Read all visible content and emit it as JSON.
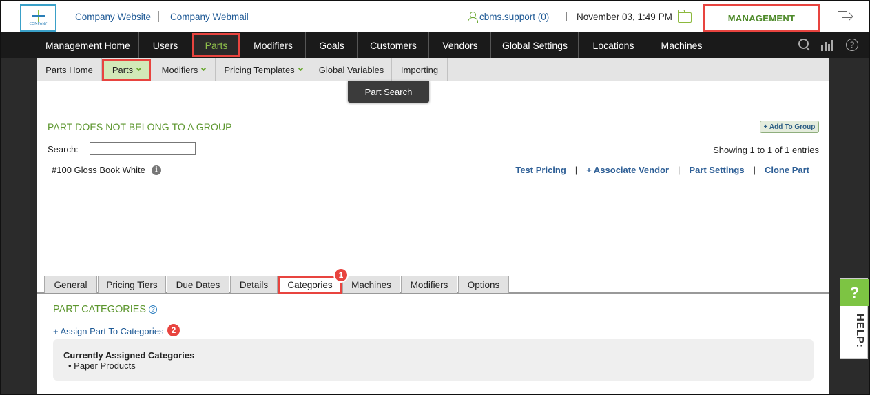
{
  "header": {
    "logo_text": "COMPANY",
    "links": [
      "Company Website",
      "Company Webmail"
    ],
    "user": "cbms.support (0)",
    "datetime": "November 03, 1:49 PM",
    "management_label": "MANAGEMENT"
  },
  "main_nav": {
    "items": [
      "Management Home",
      "Users",
      "Parts",
      "Modifiers",
      "Goals",
      "Customers",
      "Vendors",
      "Global Settings",
      "Locations",
      "Machines"
    ],
    "active": "Parts",
    "icons": [
      "search-icon",
      "chart-icon",
      "help-icon"
    ]
  },
  "sub_nav": {
    "items": [
      "Parts Home",
      "Parts",
      "Modifiers",
      "Pricing Templates",
      "Global Variables",
      "Importing"
    ],
    "active": "Parts",
    "dropdown_item": "Part Search"
  },
  "part": {
    "group_title": "PART DOES NOT BELONG TO A GROUP",
    "add_to_group": "+ Add To Group",
    "search_label": "Search:",
    "search_value": "",
    "showing": "Showing 1 to 1 of 1 entries",
    "name": "#100 Gloss Book White",
    "info_icon": "i",
    "actions": [
      "Test Pricing",
      "+ Associate Vendor",
      "Part Settings",
      "Clone Part"
    ]
  },
  "tabs": {
    "items": [
      "General",
      "Pricing Tiers",
      "Due Dates",
      "Details",
      "Categories",
      "Machines",
      "Modifiers",
      "Options"
    ],
    "active": "Categories"
  },
  "categories": {
    "title": "PART CATEGORIES",
    "help_icon": "?",
    "assign_link": "+ Assign Part To Categories",
    "assigned_heading": "Currently Assigned Categories",
    "assigned_items": [
      "Paper Products"
    ]
  },
  "annotations": {
    "badge_1": "1",
    "badge_2": "2"
  },
  "help_widget": {
    "icon": "?",
    "label": "HELP:"
  },
  "colors": {
    "accent_green": "#5c962e",
    "link_blue": "#1f5a96",
    "highlight_red": "#e8443f",
    "nav_dark": "#1a1a1a"
  }
}
